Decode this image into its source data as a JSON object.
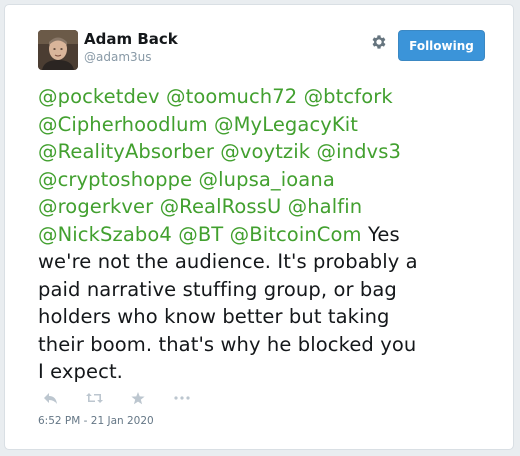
{
  "author": {
    "name": "Adam Back",
    "handle": "@adam3us"
  },
  "follow_button": {
    "label": "Following",
    "color": "#3b94d9"
  },
  "tweet": {
    "lines": [
      [
        {
          "t": "@pocketdev",
          "m": true
        },
        {
          "t": " ",
          "m": false
        },
        {
          "t": "@toomuch72",
          "m": true
        },
        {
          "t": " ",
          "m": false
        },
        {
          "t": "@btcfork",
          "m": true
        }
      ],
      [
        {
          "t": "@Cipherhoodlum",
          "m": true
        },
        {
          "t": " ",
          "m": false
        },
        {
          "t": "@MyLegacyKit",
          "m": true
        }
      ],
      [
        {
          "t": "@RealityAbsorber",
          "m": true
        },
        {
          "t": " ",
          "m": false
        },
        {
          "t": "@voytzik",
          "m": true
        },
        {
          "t": " ",
          "m": false
        },
        {
          "t": "@indvs3",
          "m": true
        }
      ],
      [
        {
          "t": "@cryptoshoppe",
          "m": true
        },
        {
          "t": " ",
          "m": false
        },
        {
          "t": "@lupsa_ioana",
          "m": true
        }
      ],
      [
        {
          "t": "@rogerkver",
          "m": true
        },
        {
          "t": " ",
          "m": false
        },
        {
          "t": "@RealRossU",
          "m": true
        },
        {
          "t": " ",
          "m": false
        },
        {
          "t": "@halfin",
          "m": true
        }
      ],
      [
        {
          "t": "@NickSzabo4",
          "m": true
        },
        {
          "t": " ",
          "m": false
        },
        {
          "t": "@BT",
          "m": true
        },
        {
          "t": " ",
          "m": false
        },
        {
          "t": "@BitcoinCom",
          "m": true
        },
        {
          "t": " Yes",
          "m": false
        }
      ],
      [
        {
          "t": "we're not the audience. It's probably a",
          "m": false
        }
      ],
      [
        {
          "t": "paid narrative stuffing group, or bag",
          "m": false
        }
      ],
      [
        {
          "t": "holders who know better but taking",
          "m": false
        }
      ],
      [
        {
          "t": "their boom. that's why he blocked you",
          "m": false
        }
      ],
      [
        {
          "t": "I expect.",
          "m": false
        }
      ]
    ],
    "mention_color": "#42a02f"
  },
  "actions": {
    "icons": [
      "reply-icon",
      "retweet-icon",
      "like-icon",
      "more-icon"
    ]
  },
  "timestamp": "6:52 PM - 21 Jan 2020"
}
